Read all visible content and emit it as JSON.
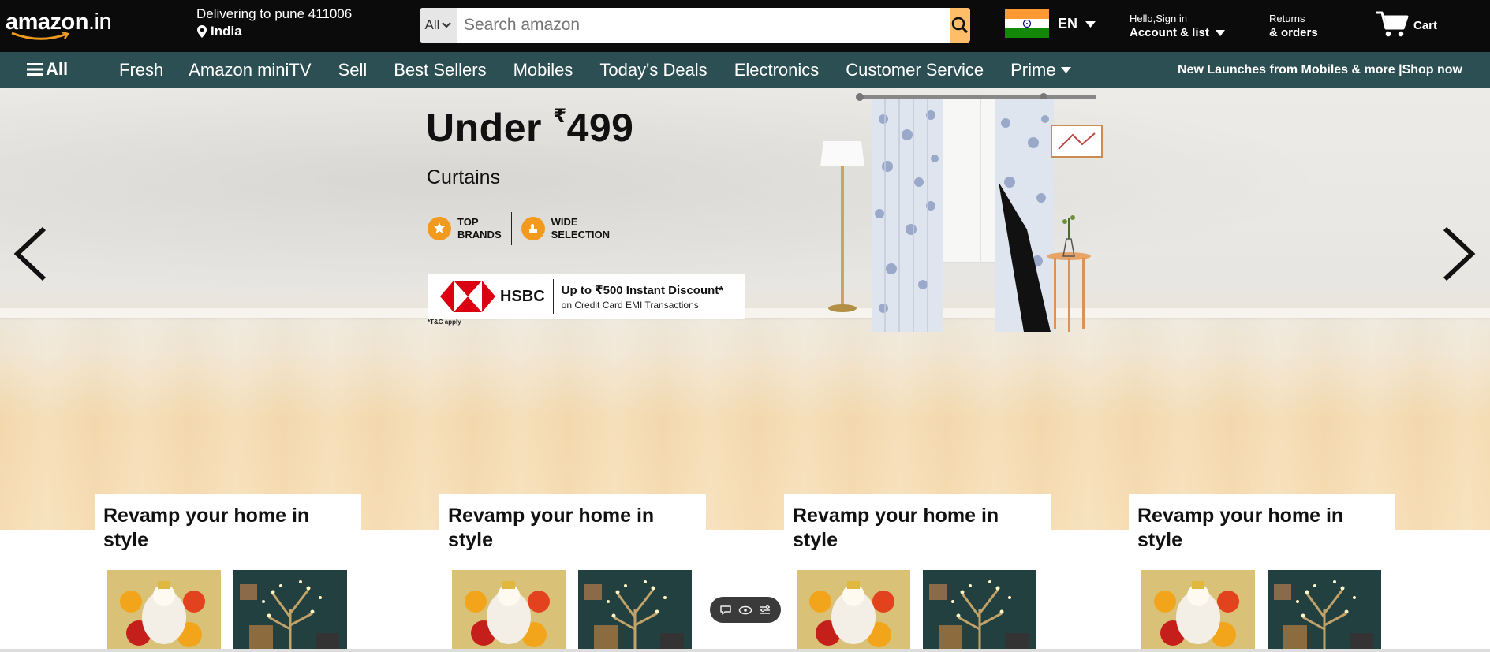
{
  "header": {
    "logo": {
      "main": "amazon",
      "suffix": ".in"
    },
    "deliver": {
      "line1": "Delivering to pune 411006",
      "line2": "India"
    },
    "search": {
      "category": "All",
      "placeholder": "Search amazon"
    },
    "language": "EN",
    "account": {
      "line1": "Hello,Sign in",
      "line2": "Account & list"
    },
    "returns": {
      "line1": "Returns",
      "line2": "& orders"
    },
    "cart": "Cart"
  },
  "nav": {
    "all": "All",
    "items": [
      "Fresh",
      "Amazon miniTV",
      "Sell",
      "Best Sellers",
      "Mobiles",
      "Today's Deals",
      "Electronics",
      "Customer Service",
      "Prime"
    ],
    "promo": "New Launches from Mobiles & more |Shop now"
  },
  "hero": {
    "title_prefix": "Under ",
    "currency": "₹",
    "price": "499",
    "subtitle": "Curtains",
    "badge1": {
      "line1": "TOP",
      "line2": "BRANDS"
    },
    "badge2": {
      "line1": "WIDE",
      "line2": "SELECTION"
    },
    "bank": "HSBC",
    "offer_line1": "Up to ₹500 Instant Discount*",
    "offer_line2": "on Credit Card EMI Transactions",
    "tnc": "*T&C apply"
  },
  "cards": [
    {
      "title": "Revamp your home in style"
    },
    {
      "title": "Revamp your home in style"
    },
    {
      "title": "Revamp your home in style"
    },
    {
      "title": "Revamp your home in style"
    }
  ],
  "colors": {
    "topbar": "#0b0b0b",
    "navbar": "#2b4f52",
    "search_button": "#febd69",
    "badge_orange": "#f29a1d",
    "hsbc_red": "#db0011"
  }
}
